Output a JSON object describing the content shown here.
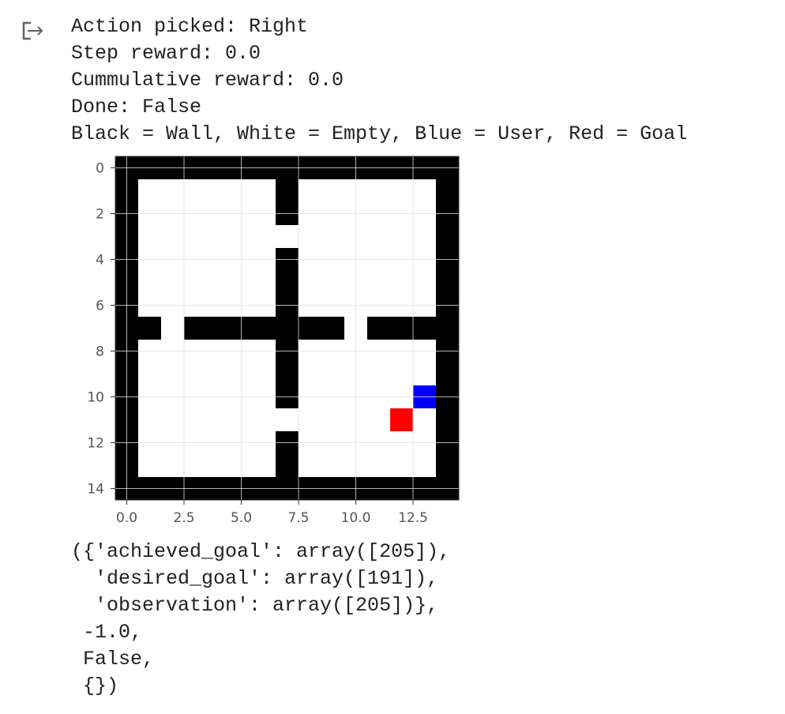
{
  "output_icon": "output-arrow-icon",
  "stdout": [
    "Action picked: Right",
    "Step reward: 0.0",
    "Cummulative reward: 0.0",
    "Done: False",
    "Black = Wall, White = Empty, Blue = User, Red = Goal"
  ],
  "chart_data": {
    "type": "heatmap",
    "grid_size": 15,
    "legend_text": "Black = Wall, White = Empty, Blue = User, Red = Goal",
    "colors": {
      "wall": "#000000",
      "empty": "#ffffff",
      "user": "#0000ff",
      "goal": "#ff0000",
      "gridline": "#e0e0e0"
    },
    "cells": [
      "WWWWWWWWWWWWWWW",
      "W......W......W",
      "W......W......W",
      "W.............W",
      "W......W......W",
      "W......W......W",
      "W......W......W",
      "WW.WWWWWWW.WWWW",
      "W......W......W",
      "W......W......W",
      "W......W.....UW",
      "W...........G.W",
      "W......W......W",
      "W......W......W",
      "WWWWWWWWWWWWWWW"
    ],
    "legend_map": {
      "W": "wall",
      ".": "empty",
      "U": "user",
      "G": "goal"
    },
    "user_position": {
      "row": 10,
      "col": 13
    },
    "goal_position": {
      "row": 11,
      "col": 12
    },
    "x_ticks": [
      "0.0",
      "2.5",
      "5.0",
      "7.5",
      "10.0",
      "12.5"
    ],
    "x_tick_values": [
      0,
      2.5,
      5,
      7.5,
      10,
      12.5
    ],
    "y_ticks": [
      "0",
      "2",
      "4",
      "6",
      "8",
      "10",
      "12",
      "14"
    ],
    "y_tick_values": [
      0,
      2,
      4,
      6,
      8,
      10,
      12,
      14
    ],
    "xlim": [
      -0.5,
      14.5
    ],
    "ylim": [
      14.5,
      -0.5
    ]
  },
  "result": [
    "({'achieved_goal': array([205]),",
    "  'desired_goal': array([191]),",
    "  'observation': array([205])},",
    " -1.0,",
    " False,",
    " {})"
  ]
}
